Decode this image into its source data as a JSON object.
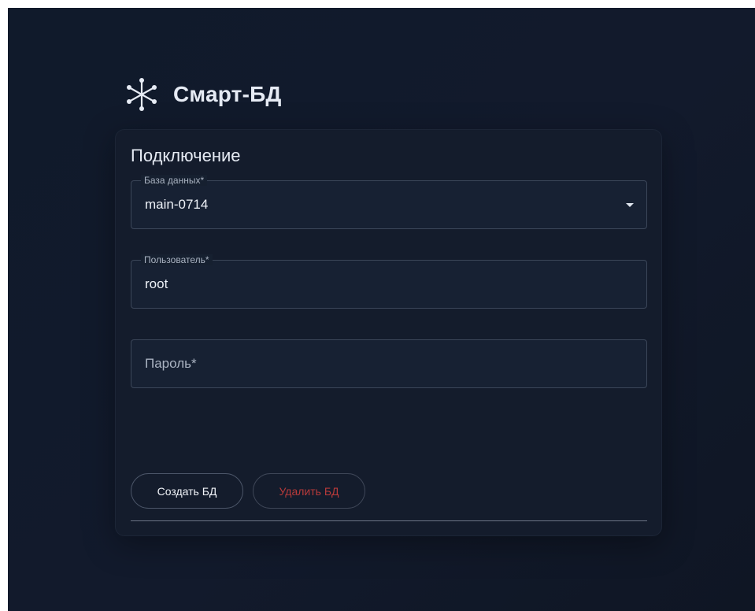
{
  "brand": {
    "title": "Смарт-БД",
    "icon": "asterisk-network-icon"
  },
  "form": {
    "title": "Подключение",
    "database": {
      "label": "База данных*",
      "value": "main-0714"
    },
    "user": {
      "label": "Пользователь*",
      "value": "root"
    },
    "password": {
      "placeholder": "Пароль*",
      "value": ""
    }
  },
  "actions": {
    "create_label": "Создать БД",
    "delete_label": "Удалить БД"
  },
  "colors": {
    "background": "#121a2c",
    "card": "#141c2c",
    "danger": "#b83a3a",
    "text": "#e6ebf4"
  }
}
